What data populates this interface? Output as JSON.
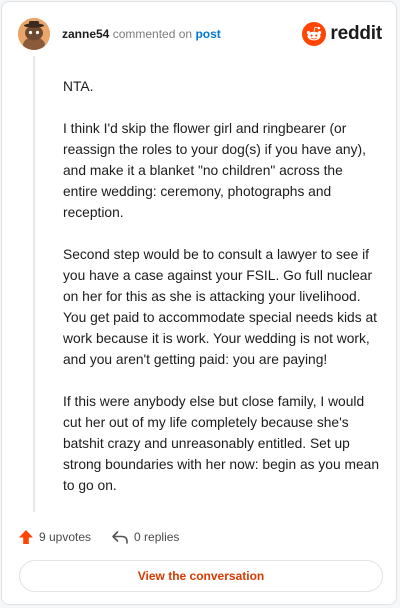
{
  "header": {
    "username": "zanne54",
    "action_text": "commented on",
    "post_link": "post",
    "brand": "reddit",
    "brand_color": "#ff4500"
  },
  "icons": {
    "avatar": "snoo-avatar-icon",
    "logo": "reddit-logo-icon",
    "upvote": "upvote-arrow-icon",
    "reply": "reply-arrow-icon"
  },
  "comment": {
    "paragraphs": [
      "NTA.",
      "I think I'd skip the flower girl and ringbearer (or reassign the roles to your dog(s) if you have any), and make it a blanket \"no children\" across the entire wedding: ceremony, photographs and reception.",
      "Second step would be to consult a lawyer to see if you have a case against your FSIL. Go full nuclear on her for this as she is attacking your livelihood. You get paid to accommodate special needs kids at work because it is work. Your wedding is not work, and you aren't getting paid: you are paying!",
      "If this were anybody else but close family, I would cut her out of my life completely because she's batshit crazy and unreasonably entitled. Set up strong boundaries with her now: begin as you mean to go on."
    ]
  },
  "actions": {
    "upvotes": "9 upvotes",
    "replies": "0 replies"
  },
  "footer": {
    "view_button": "View the conversation"
  }
}
